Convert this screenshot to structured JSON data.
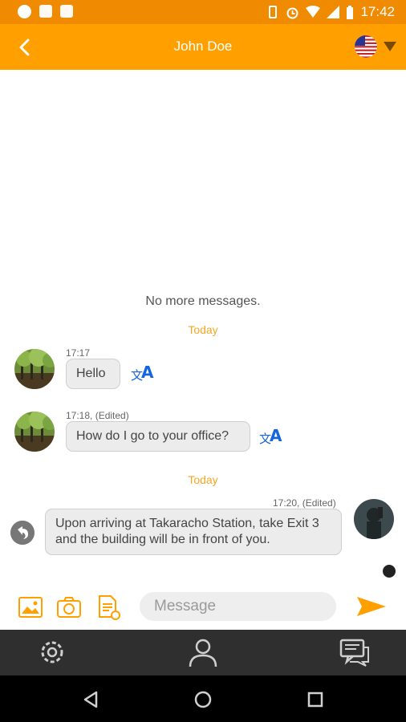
{
  "status_bar": {
    "time": "17:42",
    "icons": [
      "app-icon",
      "image-icon",
      "download-icon",
      "vibrate-icon",
      "alarm-icon",
      "wifi-icon",
      "signal-icon",
      "battery-icon"
    ]
  },
  "header": {
    "title": "John Doe",
    "back_icon": "chevron-left-icon",
    "language_flag": "us-flag-icon"
  },
  "chat": {
    "no_more_label": "No more messages.",
    "day_labels": [
      "Today",
      "Today"
    ],
    "messages": [
      {
        "side": "left",
        "time": "17:17",
        "text": "Hello"
      },
      {
        "side": "left",
        "time": "17:18, (Edited)",
        "text": "How do I go to your office?"
      },
      {
        "side": "right",
        "time": "17:20, (Edited)",
        "text": "Upon arriving at Takaracho Station, take Exit 3 and the building will be in front of you."
      }
    ]
  },
  "composer": {
    "placeholder": "Message",
    "value": ""
  },
  "colors": {
    "status_bar": "#f08a00",
    "app_bar": "#ffa000",
    "accent": "#f5a623",
    "translate_blue": "#1565e0"
  }
}
